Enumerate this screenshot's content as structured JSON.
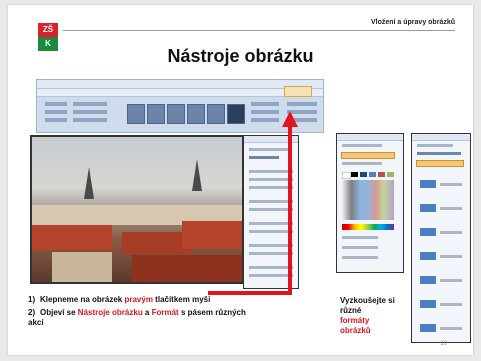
{
  "slide": {
    "header": "Vložení a úpravy obrázků",
    "logo_top": "ZŠ",
    "logo_bottom": "K",
    "title": "Nástroje obrázku",
    "page_number": "10"
  },
  "steps": [
    {
      "num": "1)",
      "parts": [
        {
          "text": "Klepneme na obrázek ",
          "red": false
        },
        {
          "text": "pravým",
          "red": true
        },
        {
          "text": " tlačítkem myši",
          "red": false
        }
      ]
    },
    {
      "num": "2)",
      "parts": [
        {
          "text": "Objeví se ",
          "red": false
        },
        {
          "text": "Nástroje obrázku",
          "red": true
        },
        {
          "text": " a ",
          "red": false
        },
        {
          "text": "Formát",
          "red": true
        },
        {
          "text": " s pásem různých akcí",
          "red": false
        }
      ]
    }
  ],
  "try_note": {
    "line1": "Vyzkoušejte si různé",
    "line2": "formáty obrázků"
  },
  "colors": {
    "accent_red": "#e0141c",
    "logo_red": "#d9242b",
    "logo_green": "#1f8a3b"
  }
}
